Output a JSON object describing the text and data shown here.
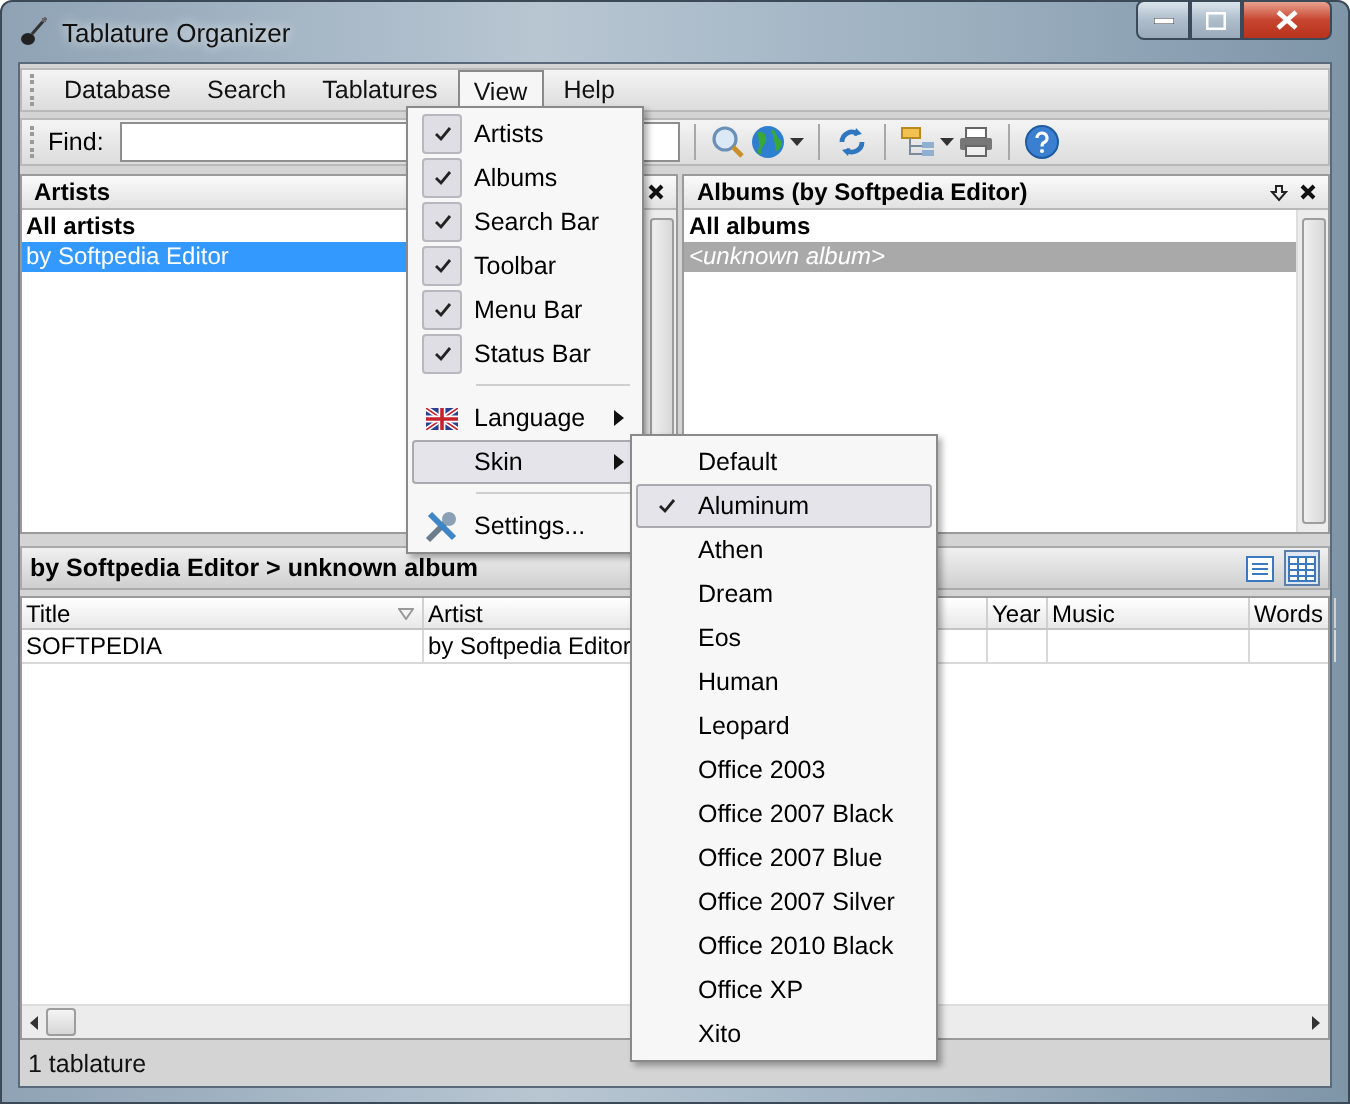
{
  "window": {
    "title": "Tablature Organizer"
  },
  "menu_bar": [
    {
      "label": "Database",
      "selected": false
    },
    {
      "label": "Search",
      "selected": false
    },
    {
      "label": "Tablatures",
      "selected": false
    },
    {
      "label": "View",
      "selected": true
    },
    {
      "label": "Help",
      "selected": false
    }
  ],
  "search_bar": {
    "label": "Find:"
  },
  "artists_panel": {
    "title": "Artists",
    "items": [
      {
        "label": "All artists",
        "kind": "all",
        "selected": false
      },
      {
        "label": "by Softpedia Editor",
        "kind": "entry",
        "selected": true
      }
    ]
  },
  "albums_panel": {
    "title": "Albums (by Softpedia Editor)",
    "items": [
      {
        "label": "All albums",
        "kind": "all",
        "selected": false
      },
      {
        "label": "<unknown album>",
        "kind": "unknown",
        "selected": true
      }
    ]
  },
  "tablatures": {
    "breadcrumb": "by Softpedia Editor > unknown album",
    "columns": [
      "Title",
      "Artist",
      "Year",
      "Music",
      "Words"
    ],
    "rows": [
      {
        "cells": [
          "SOFTPEDIA",
          "by Softpedia Editor",
          "",
          "",
          ""
        ]
      }
    ]
  },
  "view_menu": [
    {
      "kind": "check",
      "label": "Artists",
      "checked": true,
      "selected": false
    },
    {
      "kind": "check",
      "label": "Albums",
      "checked": true,
      "selected": false
    },
    {
      "kind": "check",
      "label": "Search Bar",
      "checked": true,
      "selected": false
    },
    {
      "kind": "check",
      "label": "Toolbar",
      "checked": true,
      "selected": false
    },
    {
      "kind": "check",
      "label": "Menu Bar",
      "checked": true,
      "selected": false
    },
    {
      "kind": "check",
      "label": "Status Bar",
      "checked": true,
      "selected": false
    },
    {
      "kind": "separator"
    },
    {
      "kind": "submenu",
      "label": "Language",
      "selected": false
    },
    {
      "kind": "submenu",
      "label": "Skin",
      "selected": true
    },
    {
      "kind": "separator"
    },
    {
      "kind": "command",
      "label": "Settings...",
      "selected": false
    }
  ],
  "skin_menu": [
    {
      "label": "Default",
      "selected": false
    },
    {
      "label": "Aluminum",
      "selected": true
    },
    {
      "label": "Athen",
      "selected": false
    },
    {
      "label": "Dream",
      "selected": false
    },
    {
      "label": "Eos",
      "selected": false
    },
    {
      "label": "Human",
      "selected": false
    },
    {
      "label": "Leopard",
      "selected": false
    },
    {
      "label": "Office 2003",
      "selected": false
    },
    {
      "label": "Office 2007 Black",
      "selected": false
    },
    {
      "label": "Office 2007 Blue",
      "selected": false
    },
    {
      "label": "Office 2007 Silver",
      "selected": false
    },
    {
      "label": "Office 2010 Black",
      "selected": false
    },
    {
      "label": "Office XP",
      "selected": false
    },
    {
      "label": "Xito",
      "selected": false
    }
  ],
  "status_bar": {
    "text": "1 tablature"
  }
}
